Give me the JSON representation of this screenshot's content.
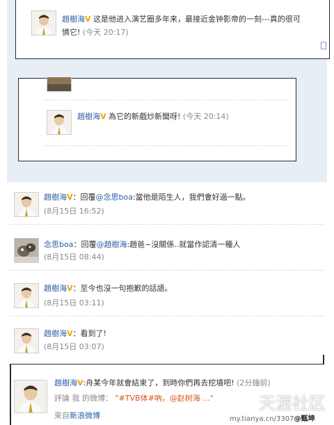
{
  "top_post": {
    "author": "趙樹海",
    "text": "这是他进入演艺圈多年来，最接近金钟影帝的一刻---真的很可",
    "text_cont": "憐它! ",
    "time": "(今天 20:17)"
  },
  "mid_post": {
    "author": "趙樹海",
    "text": "為它的新戲炒新聞呀! ",
    "time": "(今天 20:14)"
  },
  "list": [
    {
      "author": "趙樹海",
      "prefix": "：回覆",
      "mention": "@念思boa",
      "text": ":當他是陌生人，我們會好過一點。",
      "time": "(8月15日 16:52)",
      "avatar": "man"
    },
    {
      "author": "念思boa",
      "prefix": "：回覆",
      "mention": "@趙樹海",
      "text": ":趙爸~沒關係..就當作認清一種人",
      "time": "(8月15日 08:44)",
      "avatar": "animal"
    },
    {
      "author": "趙樹海",
      "prefix": "：至今也沒一句抱歉的話語。",
      "mention": "",
      "text": "",
      "time": "(8月15日 03:11)",
      "avatar": "man"
    },
    {
      "author": "趙樹海",
      "prefix": "：看到了! ",
      "mention": "",
      "text": "",
      "time": "(8月15日 03:07)",
      "avatar": "man"
    }
  ],
  "bottom_post": {
    "author": "趙樹海",
    "text": ":舟某今年就會結束了，到時你們再去挖墳吧! ",
    "time": "(2分鐘前)",
    "comment_label": "評論 我 的微博：",
    "quoted": "\"#TVB体#吶，@赵树海 ...\"",
    "source_prefix": "來自",
    "source_link": "新浪微博"
  },
  "watermark": {
    "site": "天涯社区",
    "url": "my.tianya.cn/3307",
    "user": "@甄坤"
  },
  "colors": {
    "link": "#2b5fa6",
    "vip_badge": "#e8a400",
    "time": "#888888",
    "panel": "#e8eef6"
  }
}
